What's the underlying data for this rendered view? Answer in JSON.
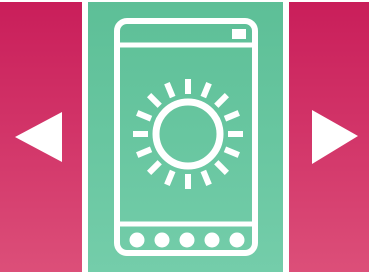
{
  "carousel": {
    "prev_icon": "triangle-left-icon",
    "next_icon": "triangle-right-icon",
    "slide_icon": "phone-with-sun-icon",
    "dots_count": 5
  },
  "colors": {
    "side_panel": "#d43a6c",
    "center_panel": "#68c6a0",
    "icon_fill": "#ffffff"
  }
}
